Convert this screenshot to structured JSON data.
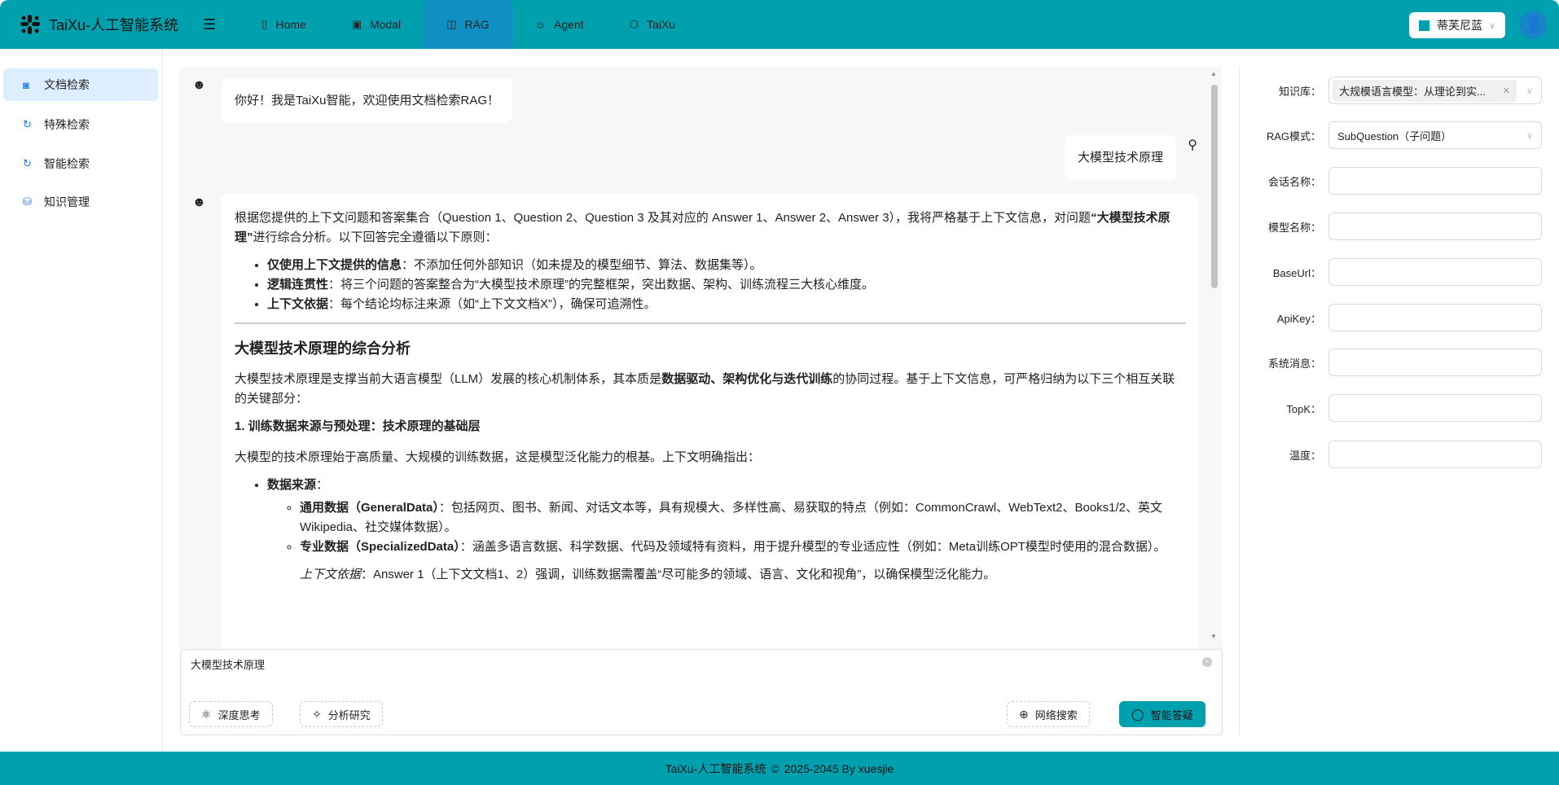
{
  "header": {
    "app_title": "TaiXu-人工智能系统",
    "nav": [
      "Home",
      "Modal",
      "RAG",
      "Agent",
      "TaiXu"
    ],
    "theme": "蒂芙尼蓝",
    "theme_color": "#00a0ae",
    "accent": "#00a0ae"
  },
  "sidebar": {
    "items": [
      "文档检索",
      "特殊检索",
      "智能检索",
      "知识管理"
    ]
  },
  "chat": {
    "greeting": "你好！我是TaiXu智能，欢迎使用文档检索RAG！",
    "user_msg": "大模型技术原理",
    "answer": {
      "intro1": "根据您提供的上下文问题和答案集合（Question 1、Question 2、Question 3 及其对应的 Answer 1、Answer 2、Answer 3），我将严格基于上下文信息，对问题",
      "intro_bold": "“大模型技术原理”",
      "intro2": "进行综合分析。以下回答完全遵循以下原则：",
      "principles": [
        {
          "b": "仅使用上下文提供的信息",
          "t": "：不添加任何外部知识（如未提及的模型细节、算法、数据集等）。"
        },
        {
          "b": "逻辑连贯性",
          "t": "：将三个问题的答案整合为“大模型技术原理”的完整框架，突出数据、架构、训练流程三大核心维度。"
        },
        {
          "b": "上下文依据",
          "t": "：每个结论均标注来源（如“上下文文档X”），确保可追溯性。"
        }
      ],
      "heading": "大模型技术原理的综合分析",
      "p1a": "大模型技术原理是支撑当前大语言模型（LLM）发展的核心机制体系，其本质是",
      "p1b": "数据驱动、架构优化与迭代训练",
      "p1c": "的协同过程。基于上下文信息，可严格归纳为以下三个相互关联的关键部分：",
      "section1": "1. 训练数据来源与预处理：技术原理的基础层",
      "p2": "大模型的技术原理始于高质量、大规模的训练数据，这是模型泛化能力的根基。上下文明确指出：",
      "data_source": "数据来源",
      "colon": "：",
      "sub": [
        {
          "b": "通用数据（GeneralData）",
          "t": "：包括网页、图书、新闻、对话文本等，具有规模大、多样性高、易获取的特点（例如：CommonCrawl、WebText2、Books1/2、英文Wikipedia、社交媒体数据）。"
        },
        {
          "b": "专业数据（SpecializedData）",
          "t": "：涵盖多语言数据、科学数据、代码及领域特有资料，用于提升模型的专业适应性（例如：Meta训练OPT模型时使用的混合数据）。"
        }
      ],
      "note_i": "上下文依据",
      "note": "：Answer 1（上下文文档1、2）强调，训练数据需覆盖“尽可能多的领域、语言、文化和视角”，以确保模型泛化能力。"
    }
  },
  "input": {
    "value": "大模型技术原理",
    "buttons": {
      "deep": "深度思考",
      "analysis": "分析研究",
      "web": "网络搜索",
      "ask": "智能答疑"
    }
  },
  "settings": {
    "kb_label": "知识库：",
    "kb_value": "大规模语言模型：从理论到实...",
    "mode_label": "RAG模式：",
    "mode_value": "SubQuestion（子问题）",
    "fields": [
      "会话名称：",
      "模型名称：",
      "BaseUrl：",
      "ApiKey：",
      "系统消息：",
      "TopK：",
      "温度："
    ]
  },
  "footer": {
    "text1": "TaiXu-人工智能系统",
    "text2": "2025-2045 By xuesjie"
  }
}
